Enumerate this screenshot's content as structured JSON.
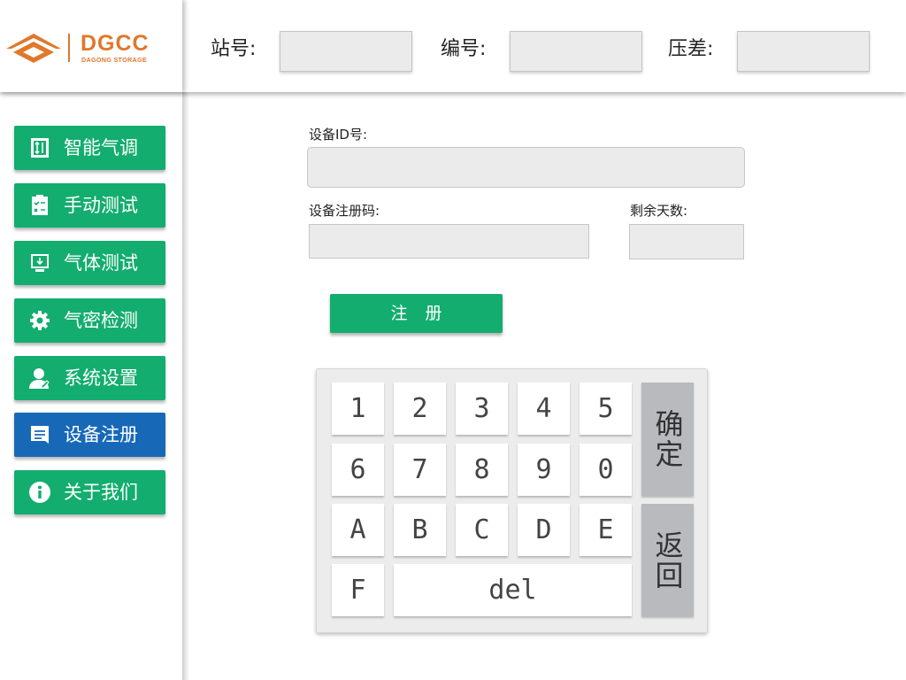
{
  "brand": {
    "name": "DGCC",
    "subtitle": "DAGONG STORAGE",
    "accent_color": "#e0782a"
  },
  "header": {
    "station_label": "站号:",
    "station_value": "",
    "number_label": "编号:",
    "number_value": "",
    "pressure_label": "压差:",
    "pressure_value": ""
  },
  "sidebar": {
    "items": [
      {
        "label": "智能气调",
        "icon": "door-arrows-icon",
        "active": false
      },
      {
        "label": "手动测试",
        "icon": "clipboard-checklist-icon",
        "active": false
      },
      {
        "label": "气体测试",
        "icon": "monitor-download-icon",
        "active": false
      },
      {
        "label": "气密检测",
        "icon": "gear-icon",
        "active": false
      },
      {
        "label": "系统设置",
        "icon": "user-settings-icon",
        "active": false
      },
      {
        "label": "设备注册",
        "icon": "document-icon",
        "active": true
      },
      {
        "label": "关于我们",
        "icon": "info-icon",
        "active": false
      }
    ],
    "color_normal": "#13ad6f",
    "color_active": "#1769b8"
  },
  "form": {
    "device_id_label": "设备ID号:",
    "device_id_value": "",
    "reg_code_label": "设备注册码:",
    "reg_code_value": "",
    "days_left_label": "剩余天数:",
    "days_left_value": "",
    "register_button": "注册"
  },
  "keypad": {
    "keys": [
      "1",
      "2",
      "3",
      "4",
      "5",
      "6",
      "7",
      "8",
      "9",
      "0",
      "A",
      "B",
      "C",
      "D",
      "E",
      "F"
    ],
    "del_label": "del",
    "confirm_label": "确定",
    "back_label": "返回"
  }
}
